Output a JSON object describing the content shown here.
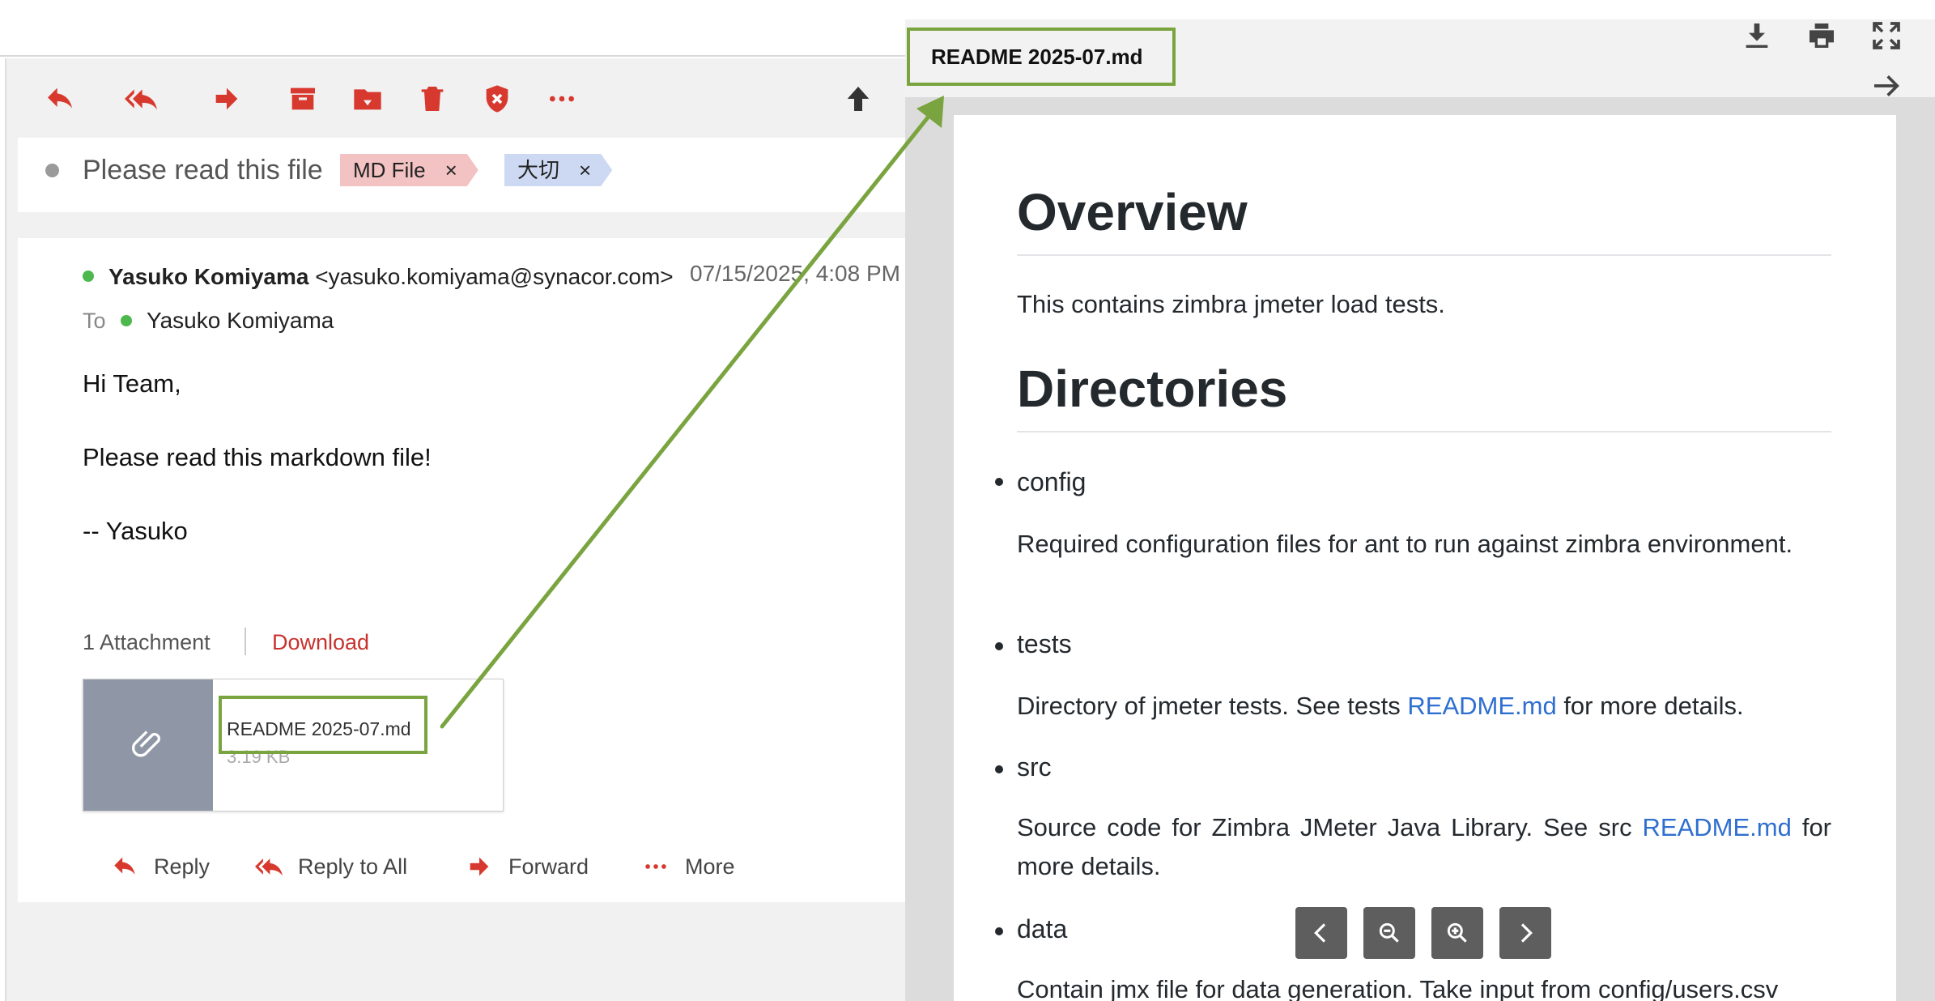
{
  "toolbar": {
    "icons": [
      "reply-icon",
      "reply-all-icon",
      "forward-icon",
      "archive-icon",
      "move-to-folder-icon",
      "delete-icon",
      "spam-icon",
      "more-icon",
      "up-icon"
    ]
  },
  "subject": {
    "text": "Please read this file",
    "tags": [
      {
        "label": "MD File",
        "remove": "×"
      },
      {
        "label": "大切",
        "remove": "×"
      }
    ]
  },
  "message": {
    "from_name": "Yasuko Komiyama",
    "from_email": "<yasuko.komiyama@synacor.com>",
    "date": "07/15/2025, 4:08 PM",
    "to_label": "To",
    "to_name": "Yasuko Komiyama",
    "body": [
      "Hi Team,",
      "Please read this markdown file!",
      "-- Yasuko"
    ]
  },
  "attachments": {
    "count_label": "1 Attachment",
    "download_label": "Download",
    "file_name": "README 2025-07.md",
    "file_size": "3.19 KB"
  },
  "actions": [
    {
      "label": "Reply",
      "icon": "reply-icon"
    },
    {
      "label": "Reply to All",
      "icon": "reply-all-icon"
    },
    {
      "label": "Forward",
      "icon": "forward-icon"
    },
    {
      "label": "More",
      "icon": "more-icon"
    }
  ],
  "preview": {
    "title": "README 2025-07.md",
    "icons": [
      "download-icon",
      "print-icon",
      "fullscreen-icon",
      "close-arrow-icon"
    ],
    "doc": {
      "h1_overview": "Overview",
      "p_overview": "This contains zimbra jmeter load tests.",
      "h1_directories": "Directories",
      "items": [
        {
          "name": "config",
          "desc": "Required configuration files for ant to run against zimbra environment."
        },
        {
          "name": "tests",
          "desc_pre": "Directory of jmeter tests. See tests ",
          "link": "README.md",
          "desc_post": " for more details."
        },
        {
          "name": "src",
          "desc_pre": "Source code for Zimbra JMeter Java Library. See src ",
          "link": "README.md",
          "desc_post": " for more details."
        },
        {
          "name": "data",
          "desc": "Contain jmx file for data generation. Take input from config/users.csv"
        }
      ]
    },
    "nav": [
      "prev-icon",
      "zoom-out-icon",
      "zoom-in-icon",
      "next-icon"
    ]
  },
  "colors": {
    "accent_red": "#c7322c",
    "annotation_green": "#7aa43f",
    "link_blue": "#2f6fd0"
  }
}
